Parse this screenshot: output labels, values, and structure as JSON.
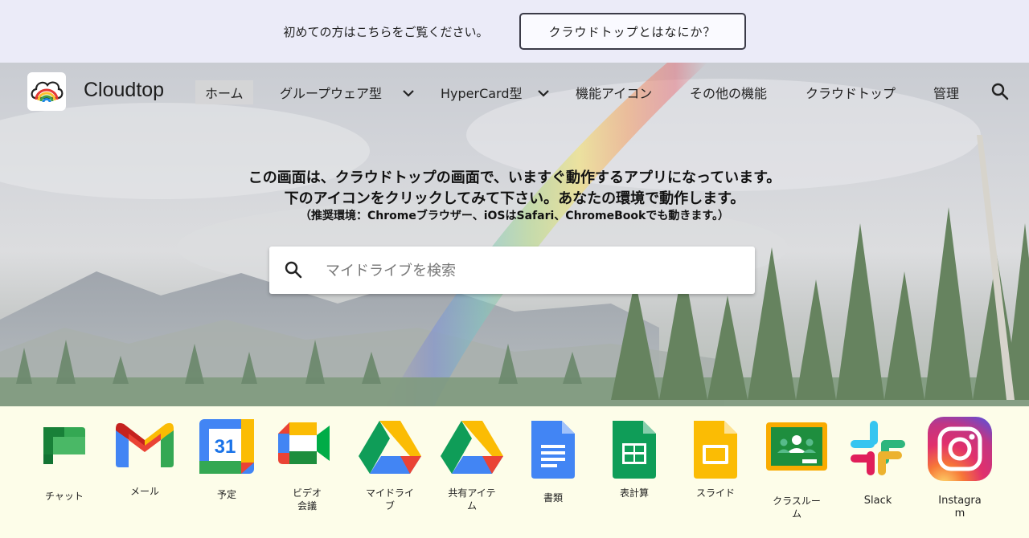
{
  "announce": {
    "text": "初めての方はこちらをご覧ください。",
    "button_label": "クラウドトップとはなにか？"
  },
  "nav": {
    "brand": "Cloudtop",
    "items": [
      {
        "label": "ホーム",
        "active": true
      },
      {
        "label": "グループウェア型",
        "dropdown": true
      },
      {
        "label": "HyperCard型",
        "dropdown": true
      },
      {
        "label": "機能アイコン"
      },
      {
        "label": "その他の機能"
      },
      {
        "label": "クラウドトップ"
      },
      {
        "label": "管理"
      }
    ],
    "search_icon": "search-icon"
  },
  "hero": {
    "line1": "この画面は、クラウドトップの画面で、いますぐ動作するアプリになっています。",
    "line2": "下のアイコンをクリックしてみて下さい。あなたの環境で動作します。",
    "line3": "（推奨環境：Chromeブラウザー、iOSはSafari、ChromeBookでも動きます。）"
  },
  "search": {
    "placeholder": "マイドライブを検索"
  },
  "apps": [
    {
      "label": "チャット",
      "icon": "google-chat-icon"
    },
    {
      "label": "メール",
      "icon": "gmail-icon"
    },
    {
      "label": "予定",
      "icon": "calendar-icon",
      "day": "31"
    },
    {
      "label": "ビデオ\n会議",
      "icon": "meet-icon"
    },
    {
      "label": "マイドライ\nブ",
      "icon": "drive-icon"
    },
    {
      "label": "共有アイテ\nム",
      "icon": "shared-drive-icon"
    },
    {
      "label": "書類",
      "icon": "docs-icon"
    },
    {
      "label": "表計算",
      "icon": "sheets-icon"
    },
    {
      "label": "スライド",
      "icon": "slides-icon"
    },
    {
      "label": "クラスルー\nム",
      "icon": "classroom-icon"
    },
    {
      "label": "Slack",
      "icon": "slack-icon"
    },
    {
      "label": "Instagra\nm",
      "icon": "instagram-icon"
    }
  ],
  "colors": {
    "announce_bg": "#ebebf8",
    "apps_bg": "#fdfde9",
    "google_blue": "#4285f4",
    "google_red": "#ea4335",
    "google_yellow": "#fbbc04",
    "google_green": "#34a853"
  }
}
